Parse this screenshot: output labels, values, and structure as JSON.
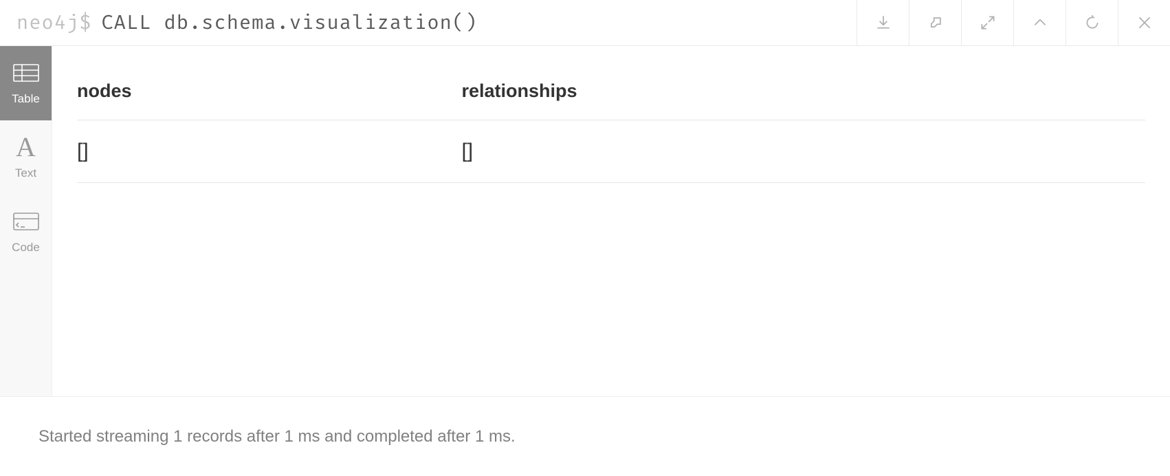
{
  "prompt": {
    "label": "neo4j$",
    "query": "CALL db.schema.visualization()"
  },
  "sidebar": {
    "tabs": [
      {
        "label": "Table"
      },
      {
        "label": "Text"
      },
      {
        "label": "Code"
      }
    ]
  },
  "table": {
    "headers": [
      "nodes",
      "relationships"
    ],
    "rows": [
      {
        "nodes": "[]",
        "relationships": "[]"
      }
    ]
  },
  "footer": {
    "status": "Started streaming 1 records after 1 ms and completed after 1 ms."
  }
}
